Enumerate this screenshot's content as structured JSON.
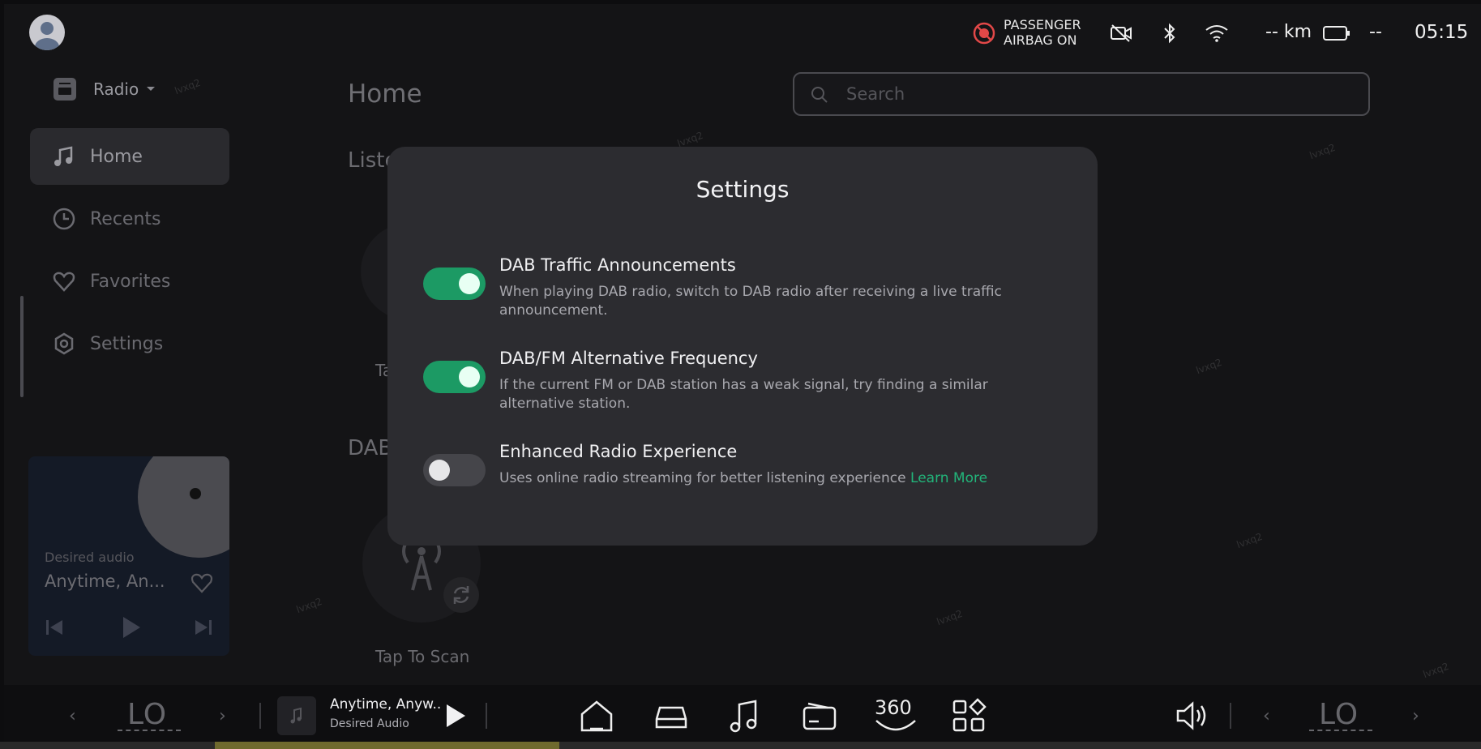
{
  "status_bar": {
    "airbag_line1": "PASSENGER",
    "airbag_line2": "AIRBAG ON",
    "distance": "-- km",
    "battery": "--",
    "time": "05:15"
  },
  "sidebar": {
    "source_label": "Radio",
    "items": [
      {
        "label": "Home",
        "icon": "music-note-icon"
      },
      {
        "label": "Recents",
        "icon": "clock-icon"
      },
      {
        "label": "Favorites",
        "icon": "heart-icon"
      },
      {
        "label": "Settings",
        "icon": "gear-icon"
      }
    ]
  },
  "main": {
    "title": "Home",
    "search_placeholder": "Search",
    "section1_partial": "Liste",
    "section1_item_partial": "Ta",
    "section2_partial": "DAB",
    "scan_label": "Tap To Scan"
  },
  "mini_player": {
    "source": "Desired audio",
    "title": "Anytime, An..."
  },
  "settings_modal": {
    "title": "Settings",
    "options": [
      {
        "title": "DAB Traffic Announcements",
        "description": "When playing DAB radio, switch to DAB radio after receiving a live traffic announcement.",
        "enabled": true
      },
      {
        "title": "DAB/FM Alternative Frequency",
        "description": "If the current FM or DAB station has a weak signal, try finding a similar alternative station.",
        "enabled": true
      },
      {
        "title": "Enhanced Radio Experience",
        "description": "Uses online radio streaming for better listening experience",
        "link": "Learn More",
        "enabled": false
      }
    ]
  },
  "dock": {
    "left_temp": "LO",
    "right_temp": "LO",
    "now_playing_title": "Anytime, Anyw..",
    "now_playing_source": "Desired Audio",
    "view_360": "360"
  },
  "colors": {
    "accent": "#1c9a64",
    "link": "#22b57a",
    "modal_bg": "#2c2c30"
  }
}
